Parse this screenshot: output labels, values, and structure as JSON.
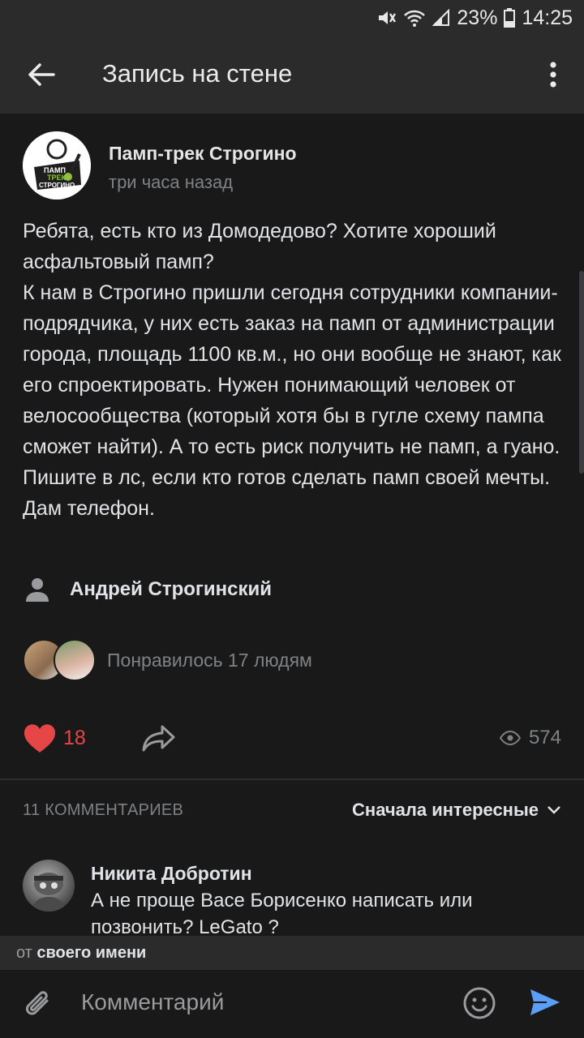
{
  "status_bar": {
    "battery_percent": "23%",
    "time": "14:25"
  },
  "app_bar": {
    "title": "Запись на стене"
  },
  "post": {
    "group_name": "Памп-трек Строгино",
    "time_ago": "три часа назад",
    "logo_text": [
      "ПАМП",
      "ТРЕК",
      "СТРОГИНО"
    ],
    "text": "Ребята, есть кто из Домодедово? Хотите хороший асфальтовый памп?\nК нам в Строгино пришли сегодня сотрудники компании-подрядчика, у них есть заказ на памп  от администрации города, площадь 1100 кв.м., но они вообще не знают, как его спроектировать. Нужен понимающий человек от велосообщества (который хотя бы в гугле схему пампа сможет найти). А то есть риск получить не памп, а гуано.\nПишите в лс, если кто готов сделать памп своей мечты. Дам телефон.",
    "signer": "Андрей Строгинский",
    "likes_text": "Понравилось 17 людям",
    "like_count": "18",
    "views": "574"
  },
  "comments": {
    "count_label": "11 КОММЕНТАРИЕВ",
    "sort_label": "Сначала интересные",
    "items": [
      {
        "author": "Никита Добротин",
        "text": "А не проще Васе Борисенко написать или позвонить? LeGato ?"
      }
    ]
  },
  "compose": {
    "from_prefix": "от",
    "from_value": "своего имени",
    "placeholder": "Комментарий"
  },
  "colors": {
    "background": "#19191a",
    "bar": "#2b2b2c",
    "like_red": "#e64646",
    "send_blue": "#5a9ef5"
  }
}
